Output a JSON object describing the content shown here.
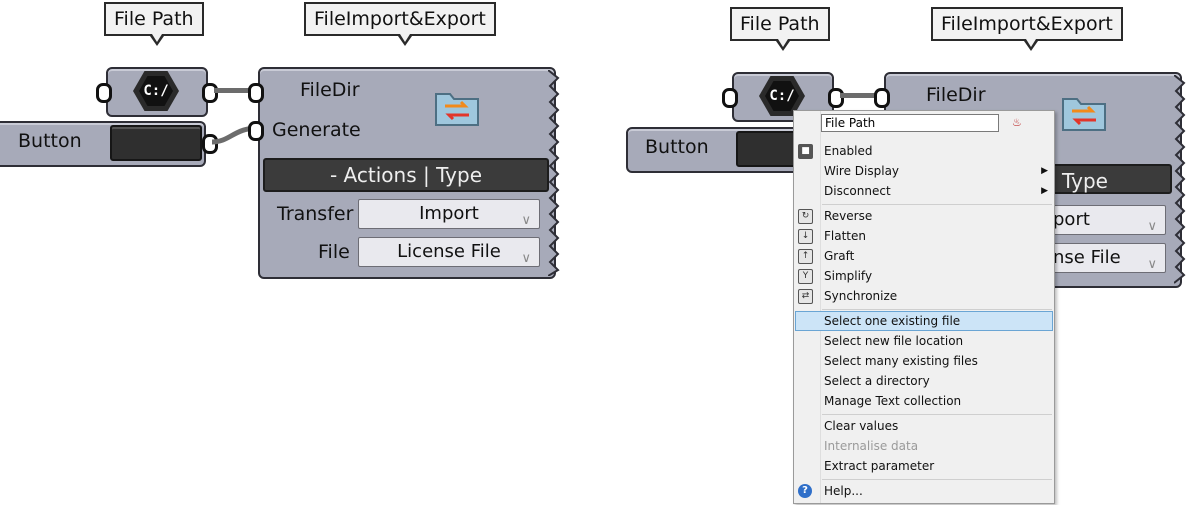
{
  "left": {
    "file_path_callout": "File Path",
    "component_callout": "FileImport&Export",
    "file_path_icon": "C:/",
    "button_label": "Button",
    "inputs": [
      "FileDir",
      "Generate"
    ],
    "section_header": "- Actions | Type",
    "rows": [
      {
        "label": "Transfer",
        "value": "Import"
      },
      {
        "label": "File",
        "value": "License File"
      }
    ]
  },
  "right": {
    "file_path_callout": "File Path",
    "component_callout": "FileImport&Export",
    "file_path_icon": "C:/",
    "button_label": "Button",
    "input_visible": "FileDir",
    "header_fragment": "Type",
    "row_fragments": [
      "port",
      "nse File"
    ]
  },
  "context_menu": {
    "name_field": "File Path",
    "groups": [
      [
        {
          "label": "Enabled",
          "icon": "enabled-icon"
        },
        {
          "label": "Wire Display",
          "submenu": true
        },
        {
          "label": "Disconnect",
          "submenu": true
        }
      ],
      [
        {
          "label": "Reverse",
          "icon": "reverse-icon"
        },
        {
          "label": "Flatten",
          "icon": "flatten-icon"
        },
        {
          "label": "Graft",
          "icon": "graft-icon"
        },
        {
          "label": "Simplify",
          "icon": "simplify-icon"
        },
        {
          "label": "Synchronize",
          "icon": "synchronize-icon"
        }
      ],
      [
        {
          "label": "Select one existing file",
          "highlighted": true
        },
        {
          "label": "Select new file location"
        },
        {
          "label": "Select many existing files"
        },
        {
          "label": "Select a directory"
        },
        {
          "label": "Manage Text collection"
        }
      ],
      [
        {
          "label": "Clear values"
        },
        {
          "label": "Internalise data",
          "disabled": true
        },
        {
          "label": "Extract parameter"
        }
      ],
      [
        {
          "label": "Help...",
          "icon": "help-icon"
        }
      ]
    ],
    "highlight_color": "#cce4f7",
    "disabled_color": "#9a9a9a"
  },
  "colors": {
    "component_fill": "#a7aab9",
    "dark_bar": "#3b3b3b",
    "wire": "#6c6c6c"
  }
}
